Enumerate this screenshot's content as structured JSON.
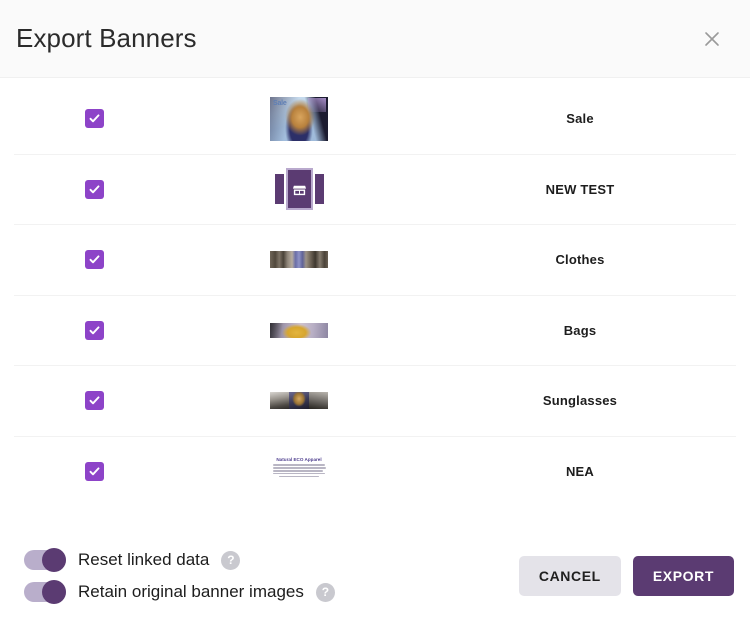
{
  "header": {
    "title": "Export Banners",
    "close_icon": "close-icon"
  },
  "banners": [
    {
      "label": "Sale",
      "checked": true,
      "thumb_kind": "photo-portrait",
      "thumb_text": "Sale"
    },
    {
      "label": "NEW TEST",
      "checked": true,
      "thumb_kind": "shop-placeholder-icon",
      "thumb_text": ""
    },
    {
      "label": "Clothes",
      "checked": true,
      "thumb_kind": "photo-wide",
      "thumb_text": ""
    },
    {
      "label": "Bags",
      "checked": true,
      "thumb_kind": "photo-wide",
      "thumb_text": ""
    },
    {
      "label": "Sunglasses",
      "checked": true,
      "thumb_kind": "photo-collage",
      "thumb_text": ""
    },
    {
      "label": "NEA",
      "checked": true,
      "thumb_kind": "text-banner",
      "thumb_text": "Natural ECO Apparel"
    }
  ],
  "footer": {
    "toggles": [
      {
        "label": "Reset linked data",
        "on": true,
        "help_icon": "help-circle-icon"
      },
      {
        "label": "Retain original banner images",
        "on": true,
        "help_icon": "help-circle-icon"
      }
    ],
    "cancel_label": "CANCEL",
    "export_label": "EXPORT"
  },
  "colors": {
    "checkbox_purple": "#8d43c8",
    "accent_purple": "#5b3b72",
    "toggle_track": "#b9aecb",
    "cancel_bg": "#e4e3e9",
    "header_bg": "#fafafa",
    "divider": "#f2f2f2"
  }
}
